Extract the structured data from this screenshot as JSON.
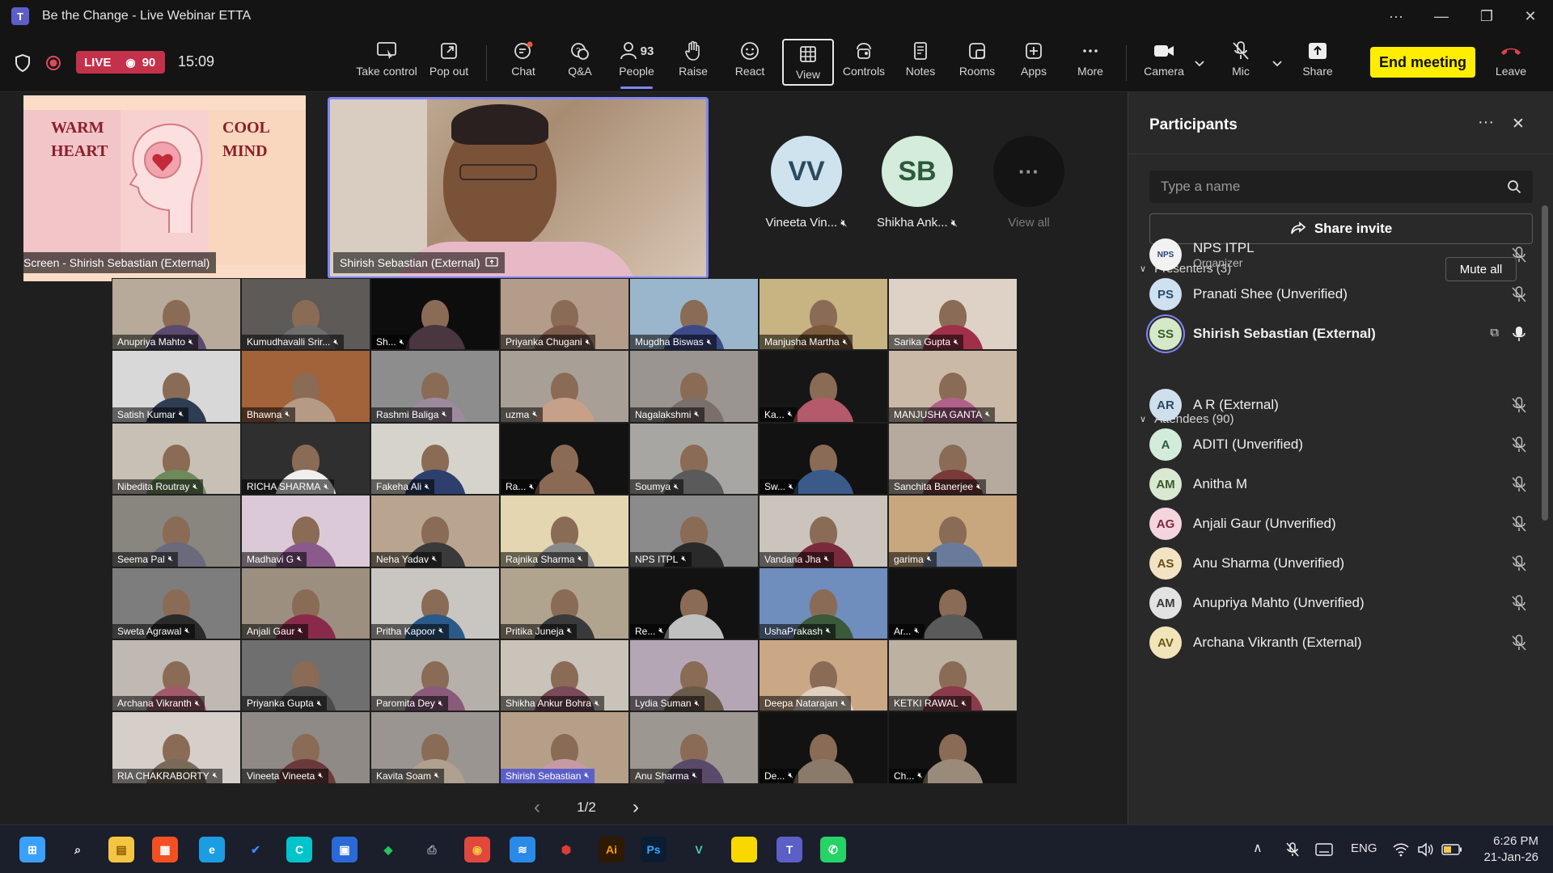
{
  "window": {
    "title": "Be the Change - Live Webinar ETTA",
    "more_glyph": "···",
    "minimize_glyph": "—",
    "restore_glyph": "❐",
    "close_glyph": "✕"
  },
  "meeting": {
    "live_label": "LIVE",
    "viewer_count": "90",
    "elapsed": "15:09",
    "accent_color": "#7f85f5",
    "live_color": "#c4314b",
    "end_color": "#ffee00"
  },
  "toolbar": {
    "take_control": "Take control",
    "pop_out": "Pop out",
    "chat": "Chat",
    "qa": "Q&A",
    "people": "People",
    "people_count": "93",
    "raise": "Raise",
    "react": "React",
    "view": "View",
    "controls": "Controls",
    "notes": "Notes",
    "rooms": "Rooms",
    "apps": "Apps",
    "more": "More",
    "camera": "Camera",
    "mic": "Mic",
    "share": "Share",
    "end_meeting": "End meeting",
    "leave": "Leave"
  },
  "stage": {
    "screen_share_label": "Screen - Shirish Sebastian (External)",
    "screen_share_left_lines": [
      "WARM",
      "HEART"
    ],
    "screen_share_right_lines": [
      "COOL",
      "MIND"
    ],
    "speaker_label": "Shirish Sebastian (External)",
    "avatars": [
      {
        "initials": "VV",
        "name": "Vineeta Vin...",
        "color": "#cfe3ef",
        "text_color": "#2b4a5e"
      },
      {
        "initials": "SB",
        "name": "Shikha Ank...",
        "color": "#d3ecdb",
        "text_color": "#2c5a3b"
      }
    ],
    "view_all_label": "View all",
    "pager": {
      "text": "1/2",
      "prev_glyph": "‹",
      "next_glyph": "›"
    }
  },
  "grid": [
    {
      "name": "Anupriya Mahto",
      "bg": "#b7aa9a",
      "shirt": "#5b4a6e"
    },
    {
      "name": "Kumudhavalli Srir...",
      "bg": "#5d5a57",
      "shirt": "#6e6e6e"
    },
    {
      "name": "Sh...",
      "bg": "#0d0d0d",
      "shirt": "#4a3640"
    },
    {
      "name": "Priyanka Chugani",
      "bg": "#b39d8a",
      "shirt": "#7d5a49"
    },
    {
      "name": "Mugdha Biswas",
      "bg": "#9ab6cc",
      "shirt": "#3c4a8a"
    },
    {
      "name": "Manjusha Martha",
      "bg": "#c8b482",
      "shirt": "#7a5a3a"
    },
    {
      "name": "Sarika Gupta",
      "bg": "#ded2c6",
      "shirt": "#a0304a"
    },
    {
      "name": "Satish Kumar",
      "bg": "#d8d8d8",
      "shirt": "#2f3d52"
    },
    {
      "name": "Bhawna",
      "bg": "#a2623a",
      "shirt": "#b59a86"
    },
    {
      "name": "Rashmi Baliga",
      "bg": "#8d8d8d",
      "shirt": "#9d8b9d"
    },
    {
      "name": "uzma",
      "bg": "#a89f96",
      "shirt": "#c7a08a"
    },
    {
      "name": "Nagalakshmi",
      "bg": "#9a9590",
      "shirt": "#7a6f6a"
    },
    {
      "name": "Ka...",
      "bg": "#161616",
      "shirt": "#b55a6a"
    },
    {
      "name": "MANJUSHA GANTA",
      "bg": "#cbb9a8",
      "shirt": "#b0608a"
    },
    {
      "name": "Nibedita Routray",
      "bg": "#c8c0b5",
      "shirt": "#6e8a5a"
    },
    {
      "name": "RICHA SHARMA",
      "bg": "#2f2f2f",
      "shirt": "#efefef"
    },
    {
      "name": "Fakeha Ali",
      "bg": "#d6d3cc",
      "shirt": "#2e3f6e"
    },
    {
      "name": "Ra...",
      "bg": "#121212",
      "shirt": "#8a6a55"
    },
    {
      "name": "Soumya",
      "bg": "#a8a6a2",
      "shirt": "#5a5a5a"
    },
    {
      "name": "Sw...",
      "bg": "#121212",
      "shirt": "#3a5a8a"
    },
    {
      "name": "Sanchita Banerjee",
      "bg": "#b5aa9d",
      "shirt": "#7a3a3a"
    },
    {
      "name": "Seema Pal",
      "bg": "#88867f",
      "shirt": "#6a6a7a"
    },
    {
      "name": "Madhavi G",
      "bg": "#dcc9d8",
      "shirt": "#8a5a8a"
    },
    {
      "name": "Neha Yadav",
      "bg": "#b9a58f",
      "shirt": "#3a3a3a"
    },
    {
      "name": "Rajnika Sharma",
      "bg": "#e3d6b0",
      "shirt": "#8a8a8a"
    },
    {
      "name": "NPS ITPL",
      "bg": "#8b8b8b",
      "shirt": "#2a2a2a"
    },
    {
      "name": "Vandana Jha",
      "bg": "#cac4bd",
      "shirt": "#7a2a3a"
    },
    {
      "name": "garima",
      "bg": "#c8a77f",
      "shirt": "#6a7a9a"
    },
    {
      "name": "Sweta Agrawal",
      "bg": "#7d7d7d",
      "shirt": "#2a2a2a"
    },
    {
      "name": "Anjali Gaur",
      "bg": "#9c8f80",
      "shirt": "#8a2a4a"
    },
    {
      "name": "Pritha Kapoor",
      "bg": "#c9c6c2",
      "shirt": "#2a5a8a"
    },
    {
      "name": "Pritika Juneja",
      "bg": "#b1a48e",
      "shirt": "#3a3a3a"
    },
    {
      "name": "Re...",
      "bg": "#121212",
      "shirt": "#c0c0c0"
    },
    {
      "name": "UshaPrakash",
      "bg": "#6f8dbd",
      "shirt": "#3a5a3a"
    },
    {
      "name": "Ar...",
      "bg": "#121212",
      "shirt": "#5a5a5a"
    },
    {
      "name": "Archana Vikranth",
      "bg": "#bfb9b2",
      "shirt": "#a05a6a"
    },
    {
      "name": "Priyanka Gupta",
      "bg": "#6f6f6f",
      "shirt": "#4a4a4a"
    },
    {
      "name": "Paromita Dey",
      "bg": "#b6b0aa",
      "shirt": "#8a5a7a"
    },
    {
      "name": "Shikha Ankur Bohra",
      "bg": "#c9c3b9",
      "shirt": "#7a4a5a"
    },
    {
      "name": "Lydia Suman",
      "bg": "#b5a6b6",
      "shirt": "#6a5a4a"
    },
    {
      "name": "Deepa Natarajan",
      "bg": "#caa785",
      "shirt": "#e0d0c0"
    },
    {
      "name": "KETKI RAWAL",
      "bg": "#bdb1a2",
      "shirt": "#8a3a4a"
    },
    {
      "name": "RIA CHAKRABORTY",
      "bg": "#d6cfc9",
      "shirt": "#7a6a5a"
    },
    {
      "name": "Vineeta Vineeta",
      "bg": "#8f8a85",
      "shirt": "#6a3a3a"
    },
    {
      "name": "Kavita Soam",
      "bg": "#9a9590",
      "shirt": "#b0a090"
    },
    {
      "name": "Shirish Sebastian",
      "bg": "#b59f89",
      "shirt": "#c79aa5",
      "highlight": true
    },
    {
      "name": "Anu Sharma",
      "bg": "#9d9792",
      "shirt": "#5a4a6a"
    },
    {
      "name": "De...",
      "bg": "#121212",
      "shirt": "#8a7a6a"
    },
    {
      "name": "Ch...",
      "bg": "#121212",
      "shirt": "#9a8a7a"
    }
  ],
  "panel": {
    "title": "Participants",
    "more_glyph": "···",
    "close_glyph": "✕",
    "search_placeholder": "Type a name",
    "share_invite": "Share invite",
    "presenters_header": "Presenters (3)",
    "mute_all": "Mute all",
    "attendees_header": "Attendees (90)",
    "presenters": [
      {
        "initials": "NPS",
        "name": "NPS ITPL",
        "role": "Organizer",
        "color": "#f2f2f2",
        "text_color": "#2a3f7a"
      },
      {
        "initials": "PS",
        "name": "Pranati Shee (Unverified)",
        "color": "#cfe0f0",
        "text_color": "#2a4a6a"
      },
      {
        "initials": "SS",
        "name": "Shirish Sebastian (External)",
        "color": "#d5e8c9",
        "text_color": "#3a5a2a",
        "speaking": true
      }
    ],
    "attendees": [
      {
        "initials": "AR",
        "name": "A R (External)",
        "color": "#cfe0ec",
        "text_color": "#2a4a62"
      },
      {
        "initials": "A",
        "name": "ADITI (Unverified)",
        "color": "#d3ecd9",
        "text_color": "#2c5a3b"
      },
      {
        "initials": "AM",
        "name": "Anitha M",
        "color": "#d9e8d0",
        "text_color": "#3a5a2a"
      },
      {
        "initials": "AG",
        "name": "Anjali Gaur (Unverified)",
        "color": "#f4d5dd",
        "text_color": "#7a2a3a"
      },
      {
        "initials": "AS",
        "name": "Anu Sharma (Unverified)",
        "color": "#f3e3c2",
        "text_color": "#6a4a1a"
      },
      {
        "initials": "AM",
        "name": "Anupriya Mahto (Unverified)",
        "color": "#e2e2e2",
        "text_color": "#3a3a3a"
      },
      {
        "initials": "AV",
        "name": "Archana Vikranth (External)",
        "color": "#f1e4b8",
        "text_color": "#6a5a1a"
      }
    ]
  },
  "taskbar": {
    "icons": [
      {
        "name": "windows-start-icon",
        "glyph": "⊞",
        "color": "#3aa0ff",
        "text": "#ffffff"
      },
      {
        "name": "search-icon",
        "glyph": "⌕",
        "color": "transparent",
        "text": "#ffffff"
      },
      {
        "name": "file-explorer-icon",
        "glyph": "▤",
        "color": "#f4c542",
        "text": "#8a5a00"
      },
      {
        "name": "microsoft-store-icon",
        "glyph": "▦",
        "color": "#f25022",
        "text": "#ffffff"
      },
      {
        "name": "edge-icon",
        "glyph": "e",
        "color": "#1b9de2",
        "text": "#ffffff"
      },
      {
        "name": "todo-icon",
        "glyph": "✔",
        "color": "transparent",
        "text": "#3a8dff"
      },
      {
        "name": "canva-icon",
        "glyph": "C",
        "color": "#00c4cc",
        "text": "#ffffff"
      },
      {
        "name": "remote-desktop-icon",
        "glyph": "▣",
        "color": "#2a6ad8",
        "text": "#ffffff"
      },
      {
        "name": "app-diamond-icon",
        "glyph": "◆",
        "color": "transparent",
        "text": "#22c55e"
      },
      {
        "name": "printer-icon",
        "glyph": "⎙",
        "color": "transparent",
        "text": "#9aa6b8"
      },
      {
        "name": "chrome-icon",
        "glyph": "◉",
        "color": "#e0483d",
        "text": "#f4c542"
      },
      {
        "name": "wifi-app-icon",
        "glyph": "≋",
        "color": "#2a8ae8",
        "text": "#ffffff"
      },
      {
        "name": "security-icon",
        "glyph": "⬢",
        "color": "transparent",
        "text": "#e03a3a"
      },
      {
        "name": "illustrator-icon",
        "glyph": "Ai",
        "color": "#2d1a04",
        "text": "#ff9a00"
      },
      {
        "name": "photoshop-icon",
        "glyph": "Ps",
        "color": "#0a1d33",
        "text": "#31a8ff"
      },
      {
        "name": "visual-studio-icon",
        "glyph": "V",
        "color": "transparent",
        "text": "#4ec9b0"
      },
      {
        "name": "sticky-notes-icon",
        "glyph": "■",
        "color": "#f8d800",
        "text": "#f8d800"
      },
      {
        "name": "teams-icon",
        "glyph": "T",
        "color": "#5b5fc7",
        "text": "#ffffff"
      },
      {
        "name": "whatsapp-icon",
        "glyph": "✆",
        "color": "#25d366",
        "text": "#ffffff"
      }
    ],
    "tray": {
      "chevron": "∧",
      "language": "ENG",
      "time": "6:26 PM",
      "date": "21-Jan-26"
    }
  }
}
